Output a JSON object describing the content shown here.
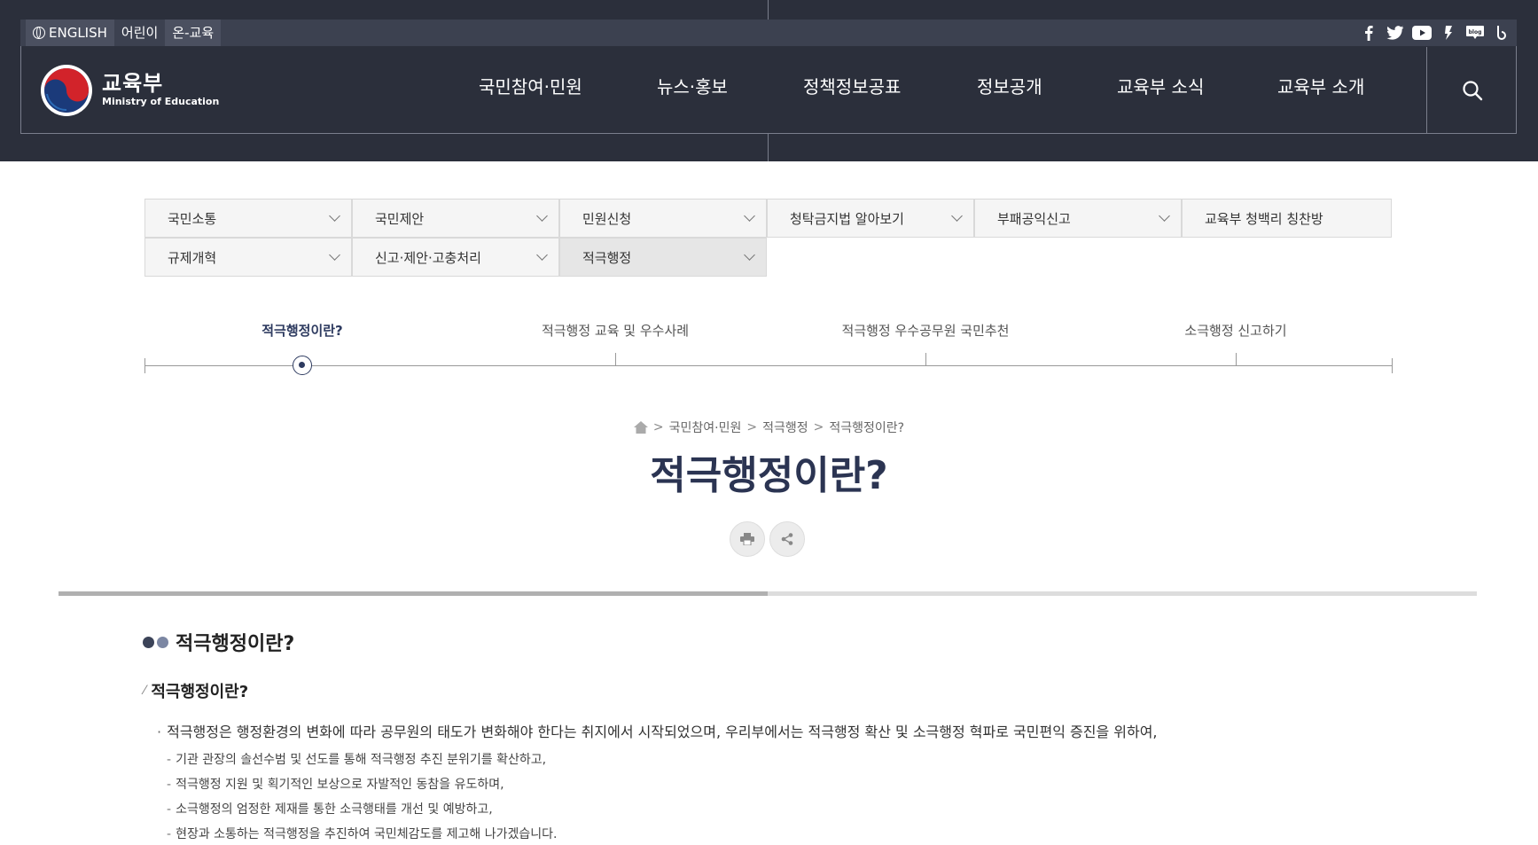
{
  "utility": {
    "links": [
      "ENGLISH",
      "어린이",
      "온-교육"
    ]
  },
  "social": {
    "icons": [
      "facebook-icon",
      "twitter-icon",
      "youtube-icon",
      "kakao-story-icon",
      "blog-icon",
      "band-icon"
    ]
  },
  "logo": {
    "name_ko": "교육부",
    "name_en": "Ministry of Education"
  },
  "gnb": {
    "items": [
      "국민참여·민원",
      "뉴스·홍보",
      "정책정보공표",
      "정보공개",
      "교육부 소식",
      "교육부 소개"
    ]
  },
  "submenu": {
    "row1": [
      "국민소통",
      "국민제안",
      "민원신청",
      "청탁금지법 알아보기",
      "부패공익신고",
      "교육부 청백리 칭찬방"
    ],
    "row2": [
      "규제개혁",
      "신고·제안·고충처리",
      "적극행정"
    ],
    "active": "적극행정"
  },
  "steps": {
    "items": [
      "적극행정이란?",
      "적극행정 교육 및 우수사례",
      "적극행정 우수공무원 국민추천",
      "소극행정 신고하기"
    ],
    "active_index": 0
  },
  "breadcrumb": {
    "items": [
      "국민참여·민원",
      "적극행정",
      "적극행정이란?"
    ]
  },
  "page": {
    "title": "적극행정이란?"
  },
  "content": {
    "h2": "적극행정이란?",
    "h3": "적극행정이란?",
    "bullet": "적극행정은 행정환경의 변화에 따라 공무원의 태도가 변화해야 한다는 취지에서 시작되었으며, 우리부에서는 적극행정 확산 및 소극행정 혁파로 국민편익 증진을 위하여,",
    "dash_items": [
      "기관 관장의 솔선수범 및 선도를 통해 적극행정 추진 분위기를 확산하고,",
      "적극행정 지원 및 획기적인 보상으로 자발적인 동참을 유도하며,",
      "소극행정의 엄정한 제재를 통한 소극행태를 개선 및 예방하고,",
      "현장과 소통하는 적극행정을 추진하여 국민체감도를 제고해 나가겠습니다."
    ]
  },
  "colors": {
    "header_bg": "#2b2f3b",
    "title": "#2b3452",
    "accent_dark": "#3b4358",
    "accent_light": "#7c87a3"
  }
}
